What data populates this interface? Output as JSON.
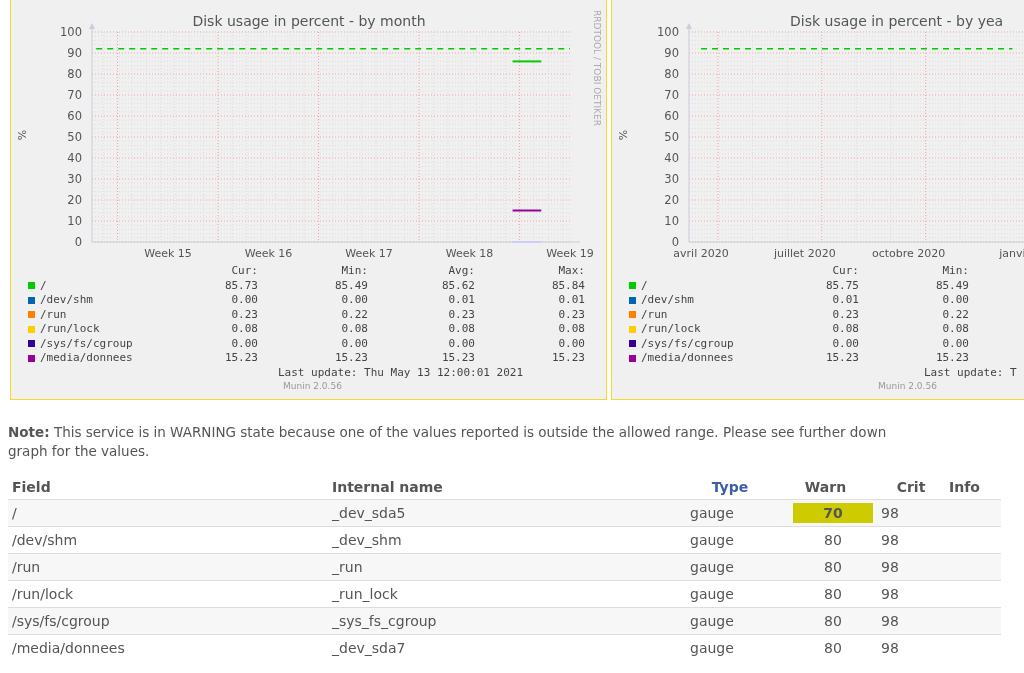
{
  "graphs": [
    {
      "side_text": "RRDTOOL / TOBI OETIKER",
      "footer": "Munin 2.0.56",
      "last_update": "Last update: Thu May 13 12:00:01 2021",
      "legend_headers": [
        "Cur:",
        "Min:",
        "Avg:",
        "Max:"
      ],
      "legend": [
        {
          "name": "/",
          "color": "#00cc00",
          "values": [
            "85.73",
            "85.49",
            "85.62",
            "85.84"
          ]
        },
        {
          "name": "/dev/shm",
          "color": "#0066b3",
          "values": [
            "0.00",
            "0.00",
            "0.01",
            "0.01"
          ]
        },
        {
          "name": "/run",
          "color": "#ff8000",
          "values": [
            "0.23",
            "0.22",
            "0.23",
            "0.23"
          ]
        },
        {
          "name": "/run/lock",
          "color": "#ffcc00",
          "values": [
            "0.08",
            "0.08",
            "0.08",
            "0.08"
          ]
        },
        {
          "name": "/sys/fs/cgroup",
          "color": "#330099",
          "values": [
            "0.00",
            "0.00",
            "0.00",
            "0.00"
          ]
        },
        {
          "name": "/media/donnees",
          "color": "#990099",
          "values": [
            "15.23",
            "15.23",
            "15.23",
            "15.23"
          ]
        }
      ],
      "chart_data": {
        "type": "line",
        "title": "Disk usage in percent - by month",
        "ylabel": "%",
        "categories": [
          null,
          null,
          null,
          null,
          null,
          "Week 15",
          null,
          null,
          null,
          null,
          null,
          null,
          "Week 16",
          null,
          null,
          null,
          null,
          null,
          null,
          "Week 17",
          null,
          null,
          null,
          null,
          null,
          null,
          "Week 18",
          null,
          null,
          null,
          null,
          null,
          null,
          "Week 19"
        ],
        "grid": true,
        "series": [
          {
            "color": "#00cc00",
            "line_style": "dashed",
            "values": [
              92,
              92,
              92,
              92,
              92,
              92,
              92,
              92,
              92,
              92,
              92,
              92,
              92,
              92,
              92,
              92,
              92,
              92,
              92,
              92,
              92,
              92,
              92,
              92,
              92,
              92,
              92,
              92,
              92,
              92,
              92,
              92,
              92,
              92
            ]
          },
          {
            "color": "#ccccff",
            "values": [
              null,
              null,
              null,
              null,
              null,
              null,
              null,
              null,
              null,
              null,
              null,
              null,
              null,
              null,
              null,
              null,
              null,
              null,
              null,
              null,
              null,
              null,
              null,
              null,
              null,
              null,
              null,
              null,
              null,
              0,
              0,
              0,
              null,
              null
            ]
          },
          {
            "color": "#990099",
            "values": [
              null,
              null,
              null,
              null,
              null,
              null,
              null,
              null,
              null,
              null,
              null,
              null,
              null,
              null,
              null,
              null,
              null,
              null,
              null,
              null,
              null,
              null,
              null,
              null,
              null,
              null,
              null,
              null,
              null,
              15,
              15,
              15,
              null,
              null
            ]
          },
          {
            "color": "#00cc00",
            "values": [
              null,
              null,
              null,
              null,
              null,
              null,
              null,
              null,
              null,
              null,
              null,
              null,
              null,
              null,
              null,
              null,
              null,
              null,
              null,
              null,
              null,
              null,
              null,
              null,
              null,
              null,
              null,
              null,
              null,
              86,
              86,
              86,
              null,
              null
            ]
          }
        ],
        "ylim": [
          0,
          100
        ],
        "yticks": [
          0,
          10,
          20,
          30,
          40,
          50,
          60,
          70,
          80,
          90,
          100
        ]
      }
    },
    {
      "footer": "Munin 2.0.56",
      "last_update": "Last update: T",
      "legend_headers": [
        "Cur:",
        "Min:"
      ],
      "legend": [
        {
          "name": "/",
          "color": "#00cc00",
          "values": [
            "85.75",
            "85.49"
          ]
        },
        {
          "name": "/dev/shm",
          "color": "#0066b3",
          "values": [
            "0.01",
            "0.00"
          ]
        },
        {
          "name": "/run",
          "color": "#ff8000",
          "values": [
            "0.23",
            "0.22"
          ]
        },
        {
          "name": "/run/lock",
          "color": "#ffcc00",
          "values": [
            "0.08",
            "0.08"
          ]
        },
        {
          "name": "/sys/fs/cgroup",
          "color": "#330099",
          "values": [
            "0.00",
            "0.00"
          ]
        },
        {
          "name": "/media/donnees",
          "color": "#990099",
          "values": [
            "15.23",
            "15.23"
          ]
        }
      ],
      "chart_data": {
        "type": "line",
        "title": "Disk usage in percent - by yea",
        "ylabel": "%",
        "categories": [
          "avril 2020",
          null,
          null,
          "juillet 2020",
          null,
          null,
          "octobre 2020",
          null,
          null,
          "janvi"
        ],
        "grid": true,
        "series": [
          {
            "color": "#00cc00",
            "line_style": "dashed",
            "values": [
              92,
              92,
              92,
              92,
              92,
              92,
              92,
              92,
              92,
              92
            ]
          }
        ],
        "ylim": [
          0,
          100
        ],
        "yticks": [
          0,
          10,
          20,
          30,
          40,
          50,
          60,
          70,
          80,
          90,
          100
        ]
      }
    }
  ],
  "note_lines": [
    "**Note:** This service is in WARNING state because one of the values reported is outside the allowed range. Please see further down",
    "graph for the values."
  ],
  "table": {
    "columns": [
      {
        "label": "Field",
        "kind": "text"
      },
      {
        "label": "Internal name",
        "kind": "text"
      },
      {
        "label": "Type",
        "kind": "link"
      },
      {
        "label": "Warn",
        "kind": "text"
      },
      {
        "label": "Crit",
        "kind": "text"
      },
      {
        "label": "Info",
        "kind": "text"
      }
    ],
    "rows": [
      {
        "field": "/",
        "internal": "_dev_sda5",
        "type": "gauge",
        "warn": "70",
        "warning": true,
        "crit": "98"
      },
      {
        "field": "/dev/shm",
        "internal": "_dev_shm",
        "type": "gauge",
        "warn": "80",
        "warning": false,
        "crit": "98"
      },
      {
        "field": "/run",
        "internal": "_run",
        "type": "gauge",
        "warn": "80",
        "warning": false,
        "crit": "98"
      },
      {
        "field": "/run/lock",
        "internal": "_run_lock",
        "type": "gauge",
        "warn": "80",
        "warning": false,
        "crit": "98"
      },
      {
        "field": "/sys/fs/cgroup",
        "internal": "_sys_fs_cgroup",
        "type": "gauge",
        "warn": "80",
        "warning": false,
        "crit": "98"
      },
      {
        "field": "/media/donnees",
        "internal": "_dev_sda7",
        "type": "gauge",
        "warn": "80",
        "warning": false,
        "crit": "98"
      }
    ]
  }
}
